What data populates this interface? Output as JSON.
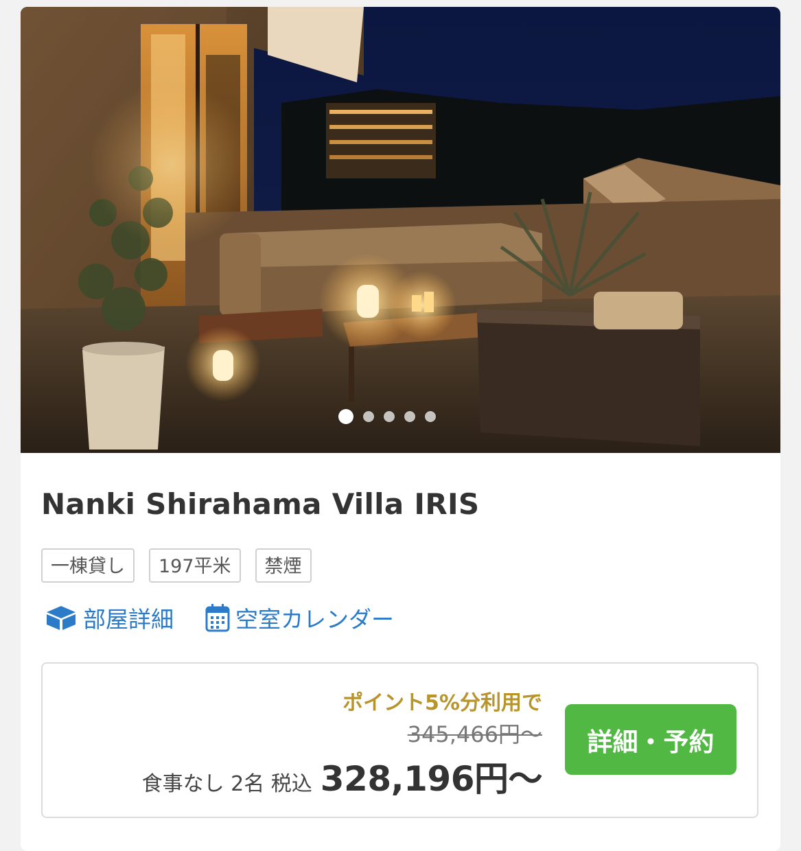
{
  "carousel": {
    "slide_count": 5,
    "active_index": 0
  },
  "listing": {
    "title": "Nanki Shirahama Villa IRIS",
    "tags": [
      "一棟貸し",
      "197平米",
      "禁煙"
    ]
  },
  "links": {
    "room_details": "部屋詳細",
    "availability_calendar": "空室カレンダー"
  },
  "pricing": {
    "promo": "ポイント5%分利用で",
    "original_price": "345,466円〜",
    "conditions": "食事なし 2名 税込",
    "price": "328,196円〜",
    "book_button": "詳細・予約"
  },
  "colors": {
    "accent_link": "#2b7bc9",
    "promo_gold": "#b8952b",
    "button_green": "#52b844"
  }
}
